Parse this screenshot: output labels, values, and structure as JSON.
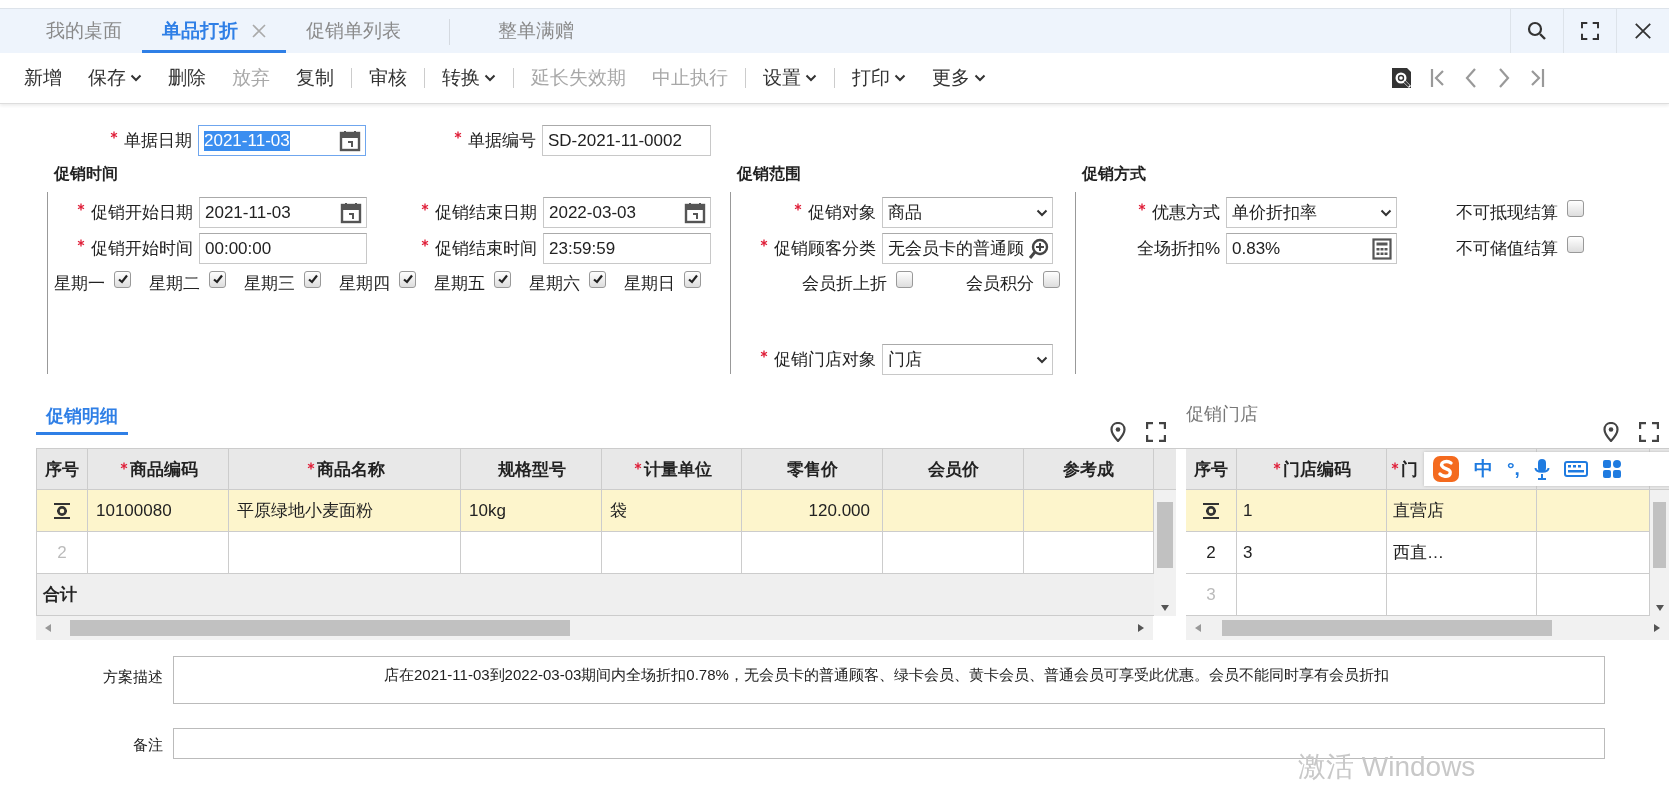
{
  "tabs": [
    {
      "label": "我的桌面",
      "selected": false,
      "closable": false
    },
    {
      "label": "单品打折",
      "selected": true,
      "closable": true
    },
    {
      "label": "促销单列表",
      "selected": false,
      "closable": false
    },
    {
      "label": "整单满赠",
      "selected": false,
      "closable": false
    }
  ],
  "toolbar": {
    "items": [
      {
        "label": "新增",
        "disabled": false,
        "dropdown": false,
        "separator_after": false
      },
      {
        "label": "保存",
        "disabled": false,
        "dropdown": true,
        "separator_after": false
      },
      {
        "label": "删除",
        "disabled": false,
        "dropdown": false,
        "separator_after": false
      },
      {
        "label": "放弃",
        "disabled": true,
        "dropdown": false,
        "separator_after": false
      },
      {
        "label": "复制",
        "disabled": false,
        "dropdown": false,
        "separator_after": true
      },
      {
        "label": "审核",
        "disabled": false,
        "dropdown": false,
        "separator_after": true
      },
      {
        "label": "转换",
        "disabled": false,
        "dropdown": true,
        "separator_after": true
      },
      {
        "label": "延长失效期",
        "disabled": true,
        "dropdown": false,
        "separator_after": false
      },
      {
        "label": "中止执行",
        "disabled": true,
        "dropdown": false,
        "separator_after": true
      },
      {
        "label": "设置",
        "disabled": false,
        "dropdown": true,
        "separator_after": true
      },
      {
        "label": "打印",
        "disabled": false,
        "dropdown": true,
        "separator_after": false
      },
      {
        "label": "更多",
        "disabled": false,
        "dropdown": true,
        "separator_after": false
      }
    ]
  },
  "header_fields": [
    {
      "kind": "date",
      "label": "单据日期",
      "required": true,
      "value": "2021-11-03",
      "text_selected": true
    },
    {
      "kind": "text",
      "label": "单据编号",
      "required": true,
      "value": "SD-2021-11-0002",
      "text_selected": false
    }
  ],
  "sections": [
    {
      "kind": "time",
      "title": "促销时间",
      "rows": [
        {
          "items": [
            {
              "kind": "date",
              "label": "促销开始日期",
              "required": true,
              "value": "2021-11-03"
            },
            {
              "kind": "date",
              "label": "促销结束日期",
              "required": true,
              "value": "2022-03-03"
            }
          ]
        },
        {
          "items": [
            {
              "kind": "text",
              "label": "促销开始时间",
              "required": true,
              "value": "00:00:00"
            },
            {
              "kind": "text",
              "label": "促销结束时间",
              "required": true,
              "value": "23:59:59"
            }
          ]
        },
        {
          "items": [
            {
              "kind": "checkbox",
              "label": "星期一",
              "checked": true
            },
            {
              "kind": "checkbox",
              "label": "星期二",
              "checked": true
            },
            {
              "kind": "checkbox",
              "label": "星期三",
              "checked": true
            },
            {
              "kind": "checkbox",
              "label": "星期四",
              "checked": true
            },
            {
              "kind": "checkbox",
              "label": "星期五",
              "checked": true
            },
            {
              "kind": "checkbox",
              "label": "星期六",
              "checked": true
            },
            {
              "kind": "checkbox",
              "label": "星期日",
              "checked": true
            }
          ]
        }
      ]
    },
    {
      "kind": "scope",
      "title": "促销范围",
      "rows": [
        {
          "items": [
            {
              "kind": "select",
              "label": "促销对象",
              "required": true,
              "value": "商品"
            }
          ]
        },
        {
          "items": [
            {
              "kind": "lookup",
              "label": "促销顾客分类",
              "required": true,
              "value": "无会员卡的普通顾"
            }
          ]
        },
        {
          "items": [
            {
              "kind": "checkbox",
              "label": "会员折上折",
              "checked": false
            },
            {
              "kind": "checkbox",
              "label": "会员积分",
              "checked": false
            }
          ]
        },
        {
          "items": [
            {
              "kind": "select",
              "label": "促销门店对象",
              "required": true,
              "value": "门店"
            }
          ]
        }
      ]
    },
    {
      "kind": "method",
      "title": "促销方式",
      "rows": [
        {
          "items": [
            {
              "kind": "select",
              "label": "优惠方式",
              "required": true,
              "value": "单价折扣率"
            },
            {
              "kind": "checkbox",
              "label": "不可抵现结算",
              "checked": false
            }
          ]
        },
        {
          "items": [
            {
              "kind": "calc",
              "label": "全场折扣%",
              "required": false,
              "value": "0.83%"
            },
            {
              "kind": "checkbox",
              "label": "不可储值结算",
              "checked": false
            }
          ]
        }
      ]
    }
  ],
  "detail": {
    "title": "促销明细",
    "selected": true,
    "columns": [
      {
        "label": "序号",
        "required": false
      },
      {
        "label": "商品编码",
        "required": true
      },
      {
        "label": "商品名称",
        "required": true
      },
      {
        "label": "规格型号",
        "required": false
      },
      {
        "label": "计量单位",
        "required": true
      },
      {
        "label": "零售价",
        "required": false
      },
      {
        "label": "会员价",
        "required": false
      },
      {
        "label": "参考成",
        "required": false
      }
    ],
    "rows": [
      {
        "selected": true,
        "cells": [
          "",
          "10100080",
          "平原绿地小麦面粉",
          "10kg",
          "袋",
          "120.000",
          "",
          ""
        ]
      },
      {
        "selected": false,
        "cells": [
          "2",
          "",
          "",
          "",
          "",
          "",
          "",
          ""
        ]
      }
    ],
    "total_label": "合计"
  },
  "stores": {
    "title": "促销门店",
    "columns": [
      {
        "label": "序号",
        "required": false
      },
      {
        "label": "门店编码",
        "required": true
      },
      {
        "label": "门",
        "required": true
      }
    ],
    "rows": [
      {
        "selected": true,
        "cells": [
          "",
          "1",
          "直营店"
        ]
      },
      {
        "selected": false,
        "cells": [
          "2",
          "3",
          "西直…"
        ]
      },
      {
        "selected": false,
        "cells": [
          "3",
          "",
          ""
        ]
      }
    ]
  },
  "ime": {
    "mode": "中",
    "punctuation": "°,"
  },
  "description": {
    "label": "方案描述",
    "value": "店在2021-11-03到2022-03-03期间内全场折扣0.78%，无会员卡的普通顾客、绿卡会员、黄卡会员、普通会员可享受此优惠。会员不能同时享有会员折扣"
  },
  "remark": {
    "label": "备注"
  },
  "os_notice": "激活 Windows"
}
